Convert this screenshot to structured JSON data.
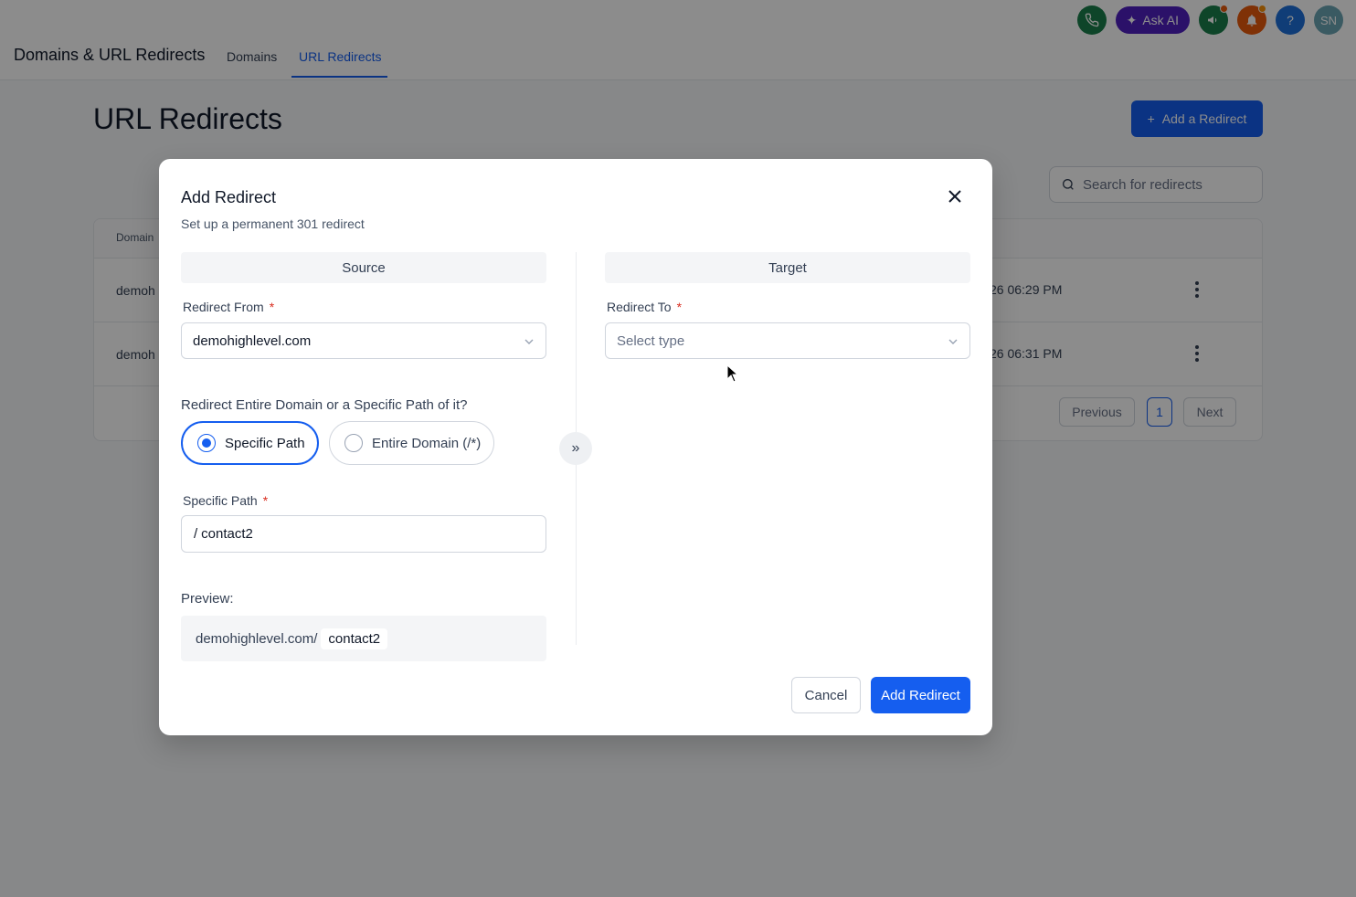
{
  "header": {
    "app_title": "Domains & URL Redirects",
    "tabs": [
      {
        "label": "Domains",
        "active": false
      },
      {
        "label": "URL Redirects",
        "active": true
      }
    ],
    "ask_ai_label": "Ask AI",
    "help_label": "?",
    "avatar_initials": "SN",
    "icons": [
      "phone-icon",
      "sparkle-icon",
      "megaphone-icon",
      "bell-icon",
      "help-icon"
    ]
  },
  "page": {
    "title": "URL Redirects",
    "add_button_label": "Add a Redirect",
    "search_placeholder": "Search for redirects",
    "table": {
      "column_domain": "Domain",
      "rows": [
        {
          "domain": "demoh",
          "date": "26 06:29 PM"
        },
        {
          "domain": "demoh",
          "date": "26 06:31 PM"
        }
      ]
    },
    "pagination": {
      "previous": "Previous",
      "current": "1",
      "next": "Next"
    }
  },
  "modal": {
    "title": "Add Redirect",
    "subtitle": "Set up a permanent 301 redirect",
    "source_header": "Source",
    "target_header": "Target",
    "redirect_from_label": "Redirect From",
    "redirect_from_value": "demohighlevel.com",
    "redirect_to_label": "Redirect To",
    "redirect_to_placeholder": "Select type",
    "question": "Redirect Entire Domain or a Specific Path of it?",
    "options": [
      {
        "label": "Specific Path",
        "selected": true
      },
      {
        "label": "Entire Domain (/*)",
        "selected": false
      }
    ],
    "specific_path_label": "Specific Path",
    "path_prefix": "/",
    "path_value": "contact2",
    "preview_label": "Preview:",
    "preview_domain": "demohighlevel.com/",
    "preview_path": "contact2",
    "required_mark": "*",
    "cancel_label": "Cancel",
    "submit_label": "Add Redirect"
  },
  "colors": {
    "primary": "#155eef",
    "phone_green": "#1a7f4b",
    "ask_ai_purple": "#4f1fbf",
    "bell_orange": "#e8590c",
    "help_blue": "#1e6fd9",
    "avatar_teal": "#6ba5b3",
    "required_red": "#d92d20"
  }
}
